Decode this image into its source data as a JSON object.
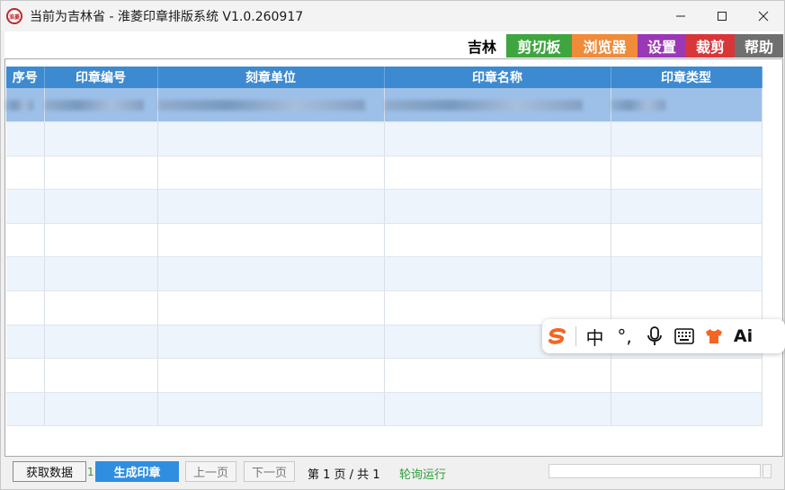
{
  "window": {
    "title": "当前为吉林省 - 淮菱印章排版系统 V1.0.260917",
    "icon_text": "淮菱",
    "controls": [
      "minimize-icon",
      "maximize-icon",
      "close-icon"
    ]
  },
  "toolbar": {
    "tabs": [
      {
        "label": "吉林",
        "color": "#ffffff",
        "text_color": "#000000"
      },
      {
        "label": "剪切板",
        "color": "#3fa63f",
        "text_color": "#ffffff"
      },
      {
        "label": "浏览器",
        "color": "#f08b3a",
        "text_color": "#ffffff"
      },
      {
        "label": "设置",
        "color": "#9b38b5",
        "text_color": "#ffffff"
      },
      {
        "label": "裁剪",
        "color": "#d9363a",
        "text_color": "#ffffff"
      },
      {
        "label": "帮助",
        "color": "#6f6f6f",
        "text_color": "#ffffff"
      }
    ]
  },
  "grid": {
    "columns": [
      "序号",
      "印章编号",
      "刻章单位",
      "印章名称",
      "印章类型"
    ],
    "rows": [
      {
        "seq": "",
        "code": "2202...",
        "unit": "",
        "name": "",
        "type": "",
        "selected": true
      }
    ],
    "empty_rows": 9
  },
  "bottom": {
    "fetch_label": "获取数据",
    "mark_label": "1",
    "generate_label": "生成印章",
    "prev_label": "上一页",
    "next_label": "下一页",
    "page_info": "第 1 页 / 共 1",
    "status_text": "轮询运行",
    "progress": 1.0
  },
  "ime": {
    "items": [
      "sogou-logo-icon",
      "中",
      "°,",
      "microphone-icon",
      "keyboard-icon",
      "skin-shirt-icon",
      "Ai"
    ]
  }
}
